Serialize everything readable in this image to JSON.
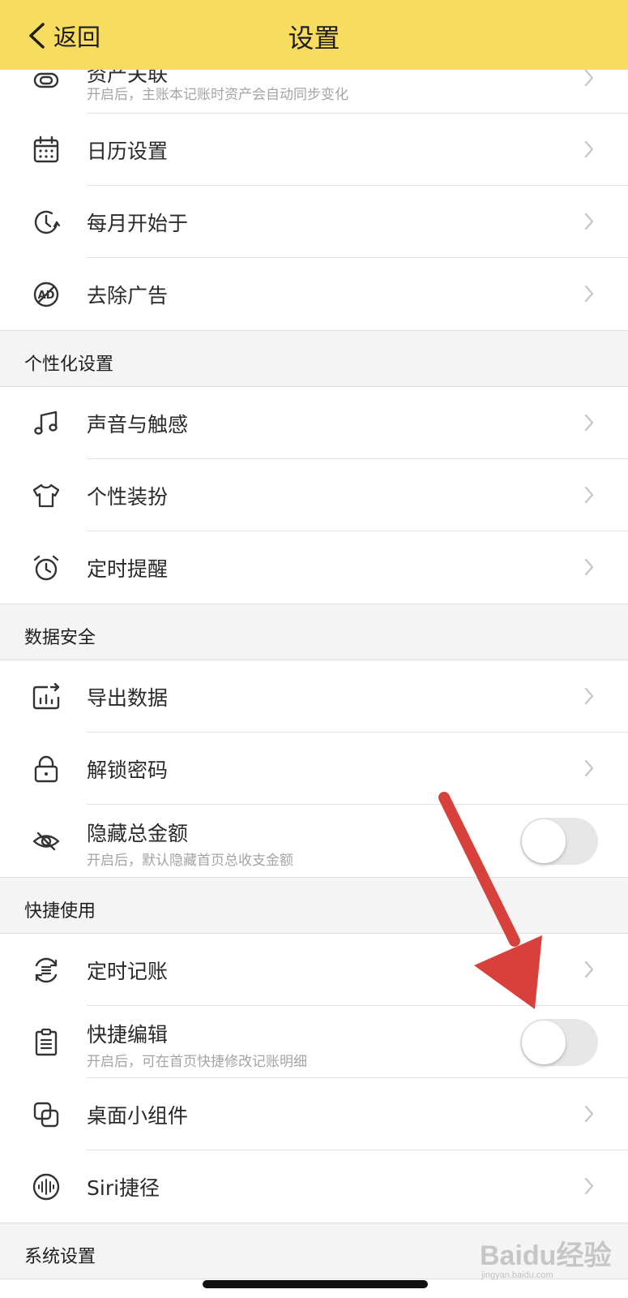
{
  "header": {
    "back_label": "返回",
    "title": "设置"
  },
  "rows_top": [
    {
      "label": "资产关联",
      "sublabel": "开启后，主账本记账时资产会自动同步变化",
      "icon": "link-icon"
    },
    {
      "label": "日历设置",
      "icon": "calendar-icon"
    },
    {
      "label": "每月开始于",
      "icon": "clock-icon"
    },
    {
      "label": "去除广告",
      "icon": "no-ad-icon"
    }
  ],
  "sections": {
    "personal": {
      "title": "个性化设置",
      "items": [
        {
          "label": "声音与触感",
          "icon": "music-note-icon"
        },
        {
          "label": "个性装扮",
          "icon": "tshirt-icon"
        },
        {
          "label": "定时提醒",
          "icon": "alarm-clock-icon"
        }
      ]
    },
    "security": {
      "title": "数据安全",
      "items": [
        {
          "label": "导出数据",
          "icon": "export-icon"
        },
        {
          "label": "解锁密码",
          "icon": "lock-icon"
        },
        {
          "label": "隐藏总金额",
          "sublabel": "开启后，默认隐藏首页总收支金额",
          "icon": "eye-off-icon",
          "toggle": false
        }
      ]
    },
    "shortcut": {
      "title": "快捷使用",
      "items": [
        {
          "label": "定时记账",
          "icon": "recurring-icon"
        },
        {
          "label": "快捷编辑",
          "sublabel": "开启后，可在首页快捷修改记账明细",
          "icon": "clipboard-icon",
          "toggle": false
        },
        {
          "label": "桌面小组件",
          "icon": "widget-icon"
        },
        {
          "label": "Siri捷径",
          "icon": "siri-icon"
        }
      ]
    },
    "system": {
      "title": "系统设置"
    }
  },
  "watermark": {
    "text": "Baidu经验",
    "sub": "jingyan.baidu.com"
  },
  "colors": {
    "header_bg": "#f8dc5f",
    "section_bg": "#f4f4f4",
    "arrow": "#d8403b"
  }
}
